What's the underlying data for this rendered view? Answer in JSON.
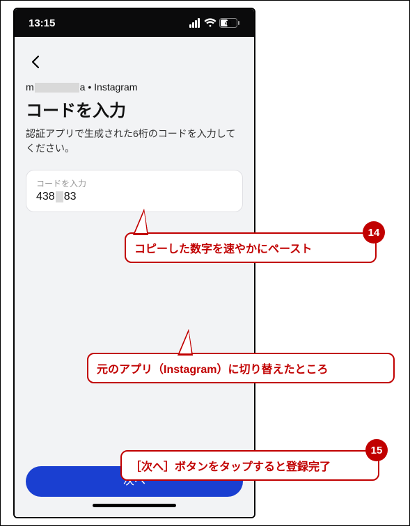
{
  "status": {
    "time": "13:15",
    "battery_pct": "41"
  },
  "screen": {
    "account_prefix": "m",
    "account_suffix": "a",
    "service_suffix": " • Instagram",
    "title": "コードを入力",
    "description": "認証アプリで生成された6桁のコードを入力してください。",
    "input_label": "コードを入力",
    "input_value_pre": "438",
    "input_value_post": "83",
    "next_label": "次へ"
  },
  "annotations": {
    "a14": {
      "badge": "14",
      "text": "コピーした数字を速やかにペースト"
    },
    "a_mid": {
      "text": "元のアプリ（Instagram）に切り替えたところ"
    },
    "a15": {
      "badge": "15",
      "text": "［次へ］ボタンをタップすると登録完了"
    }
  }
}
